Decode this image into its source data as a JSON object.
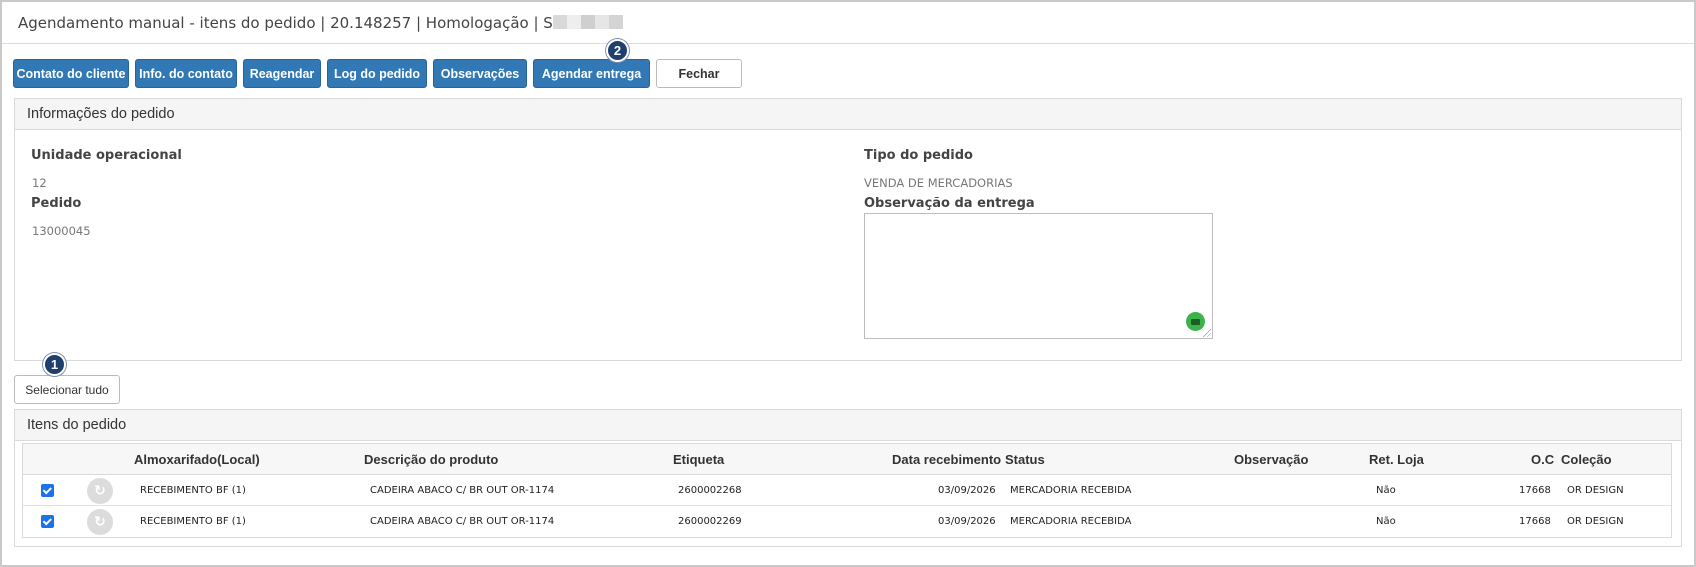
{
  "window": {
    "title": "Agendamento manual - itens do pedido | 20.148257 | Homologação | S"
  },
  "toolbar": {
    "contato_cliente": "Contato do cliente",
    "info_contato": "Info. do contato",
    "reagendar": "Reagendar",
    "log_pedido": "Log do pedido",
    "observacoes": "Observações",
    "agendar_entrega": "Agendar entrega",
    "fechar": "Fechar",
    "badge_agendar": "2"
  },
  "info_panel": {
    "heading": "Informações do pedido",
    "unidade_label": "Unidade operacional",
    "unidade_value": "12",
    "pedido_label": "Pedido",
    "pedido_value": "13000045",
    "tipo_label": "Tipo do pedido",
    "tipo_value": "VENDA DE MERCADORIAS",
    "obs_entrega_label": "Observação da entrega",
    "obs_entrega_value": ""
  },
  "select_all": {
    "label": "Selecionar tudo",
    "badge": "1"
  },
  "items_panel": {
    "heading": "Itens do pedido",
    "columns": {
      "almoxarifado": "Almoxarifado(Local)",
      "descricao": "Descrição do produto",
      "etiqueta": "Etiqueta",
      "data_recebimento": "Data recebimento",
      "status": "Status",
      "observacao": "Observação",
      "ret_loja": "Ret. Loja",
      "oc": "O.C",
      "colecao": "Coleção"
    },
    "rows": [
      {
        "checked": true,
        "almoxarifado": "RECEBIMENTO BF (1)",
        "descricao": "CADEIRA ABACO C/ BR OUT OR-1174",
        "etiqueta": "2600002268",
        "data_recebimento": "03/09/2026",
        "status": "MERCADORIA RECEBIDA",
        "observacao": "",
        "ret_loja": "Não",
        "oc": "17668",
        "colecao": "OR DESIGN"
      },
      {
        "checked": true,
        "almoxarifado": "RECEBIMENTO BF (1)",
        "descricao": "CADEIRA ABACO C/ BR OUT OR-1174",
        "etiqueta": "2600002269",
        "data_recebimento": "03/09/2026",
        "status": "MERCADORIA RECEBIDA",
        "observacao": "",
        "ret_loja": "Não",
        "oc": "17668",
        "colecao": "OR DESIGN"
      }
    ]
  },
  "colors": {
    "primary_button": "#3278b5",
    "badge": "#1f3f6e",
    "checkbox": "#1a73e8"
  },
  "icons": {
    "history": "history-icon",
    "textarea_tool": "grammar-helper-icon"
  }
}
